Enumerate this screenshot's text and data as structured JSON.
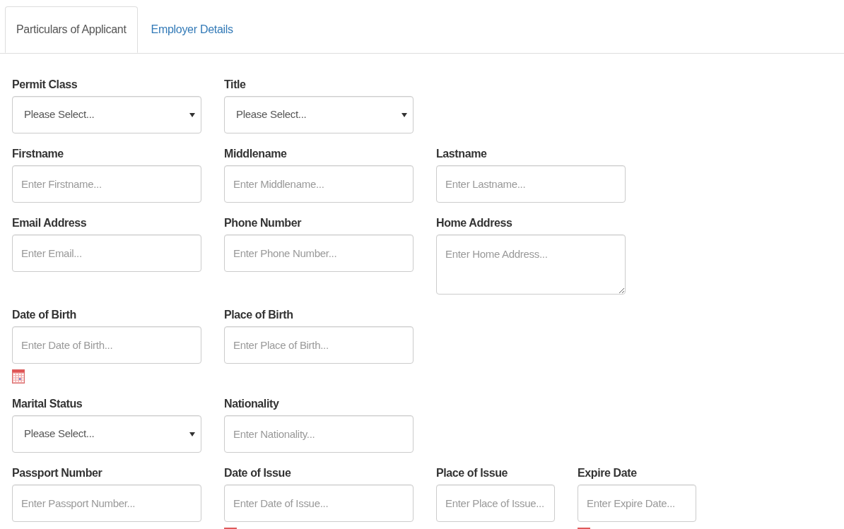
{
  "tabs": [
    {
      "label": "Particulars of Applicant",
      "selected": true
    },
    {
      "label": "Employer Details",
      "selected": false
    }
  ],
  "rows": [
    {
      "fields": [
        {
          "label": "Permit Class",
          "kind": "select",
          "placeholder": "Please Select..."
        },
        {
          "label": "Title",
          "kind": "select",
          "placeholder": "Please Select..."
        }
      ]
    },
    {
      "fields": [
        {
          "label": "Firstname",
          "kind": "text",
          "placeholder": "Enter Firstname..."
        },
        {
          "label": "Middlename",
          "kind": "text",
          "placeholder": "Enter Middlename..."
        },
        {
          "label": "Lastname",
          "kind": "text",
          "placeholder": "Enter Lastname..."
        }
      ]
    },
    {
      "fields": [
        {
          "label": "Email Address",
          "kind": "text",
          "placeholder": "Enter Email..."
        },
        {
          "label": "Phone Number",
          "kind": "text",
          "placeholder": "Enter Phone Number..."
        },
        {
          "label": "Home Address",
          "kind": "textarea",
          "placeholder": "Enter Home Address..."
        }
      ]
    },
    {
      "fields": [
        {
          "label": "Date of Birth",
          "kind": "date",
          "placeholder": "Enter Date of Birth..."
        },
        {
          "label": "Place of Birth",
          "kind": "text",
          "placeholder": "Enter Place of Birth..."
        }
      ]
    },
    {
      "fields": [
        {
          "label": "Marital Status",
          "kind": "select",
          "placeholder": "Please Select..."
        },
        {
          "label": "Nationality",
          "kind": "text",
          "placeholder": "Enter Nationality..."
        }
      ]
    },
    {
      "fields": [
        {
          "label": "Passport Number",
          "kind": "text",
          "placeholder": "Enter Passport Number..."
        },
        {
          "label": "Date of Issue",
          "kind": "date",
          "placeholder": "Enter Date of Issue..."
        },
        {
          "label": "Place of Issue",
          "kind": "text",
          "placeholder": "Enter Place of Issue..."
        },
        {
          "label": "Expire Date",
          "kind": "date",
          "placeholder": "Enter Expire Date..."
        }
      ]
    }
  ]
}
